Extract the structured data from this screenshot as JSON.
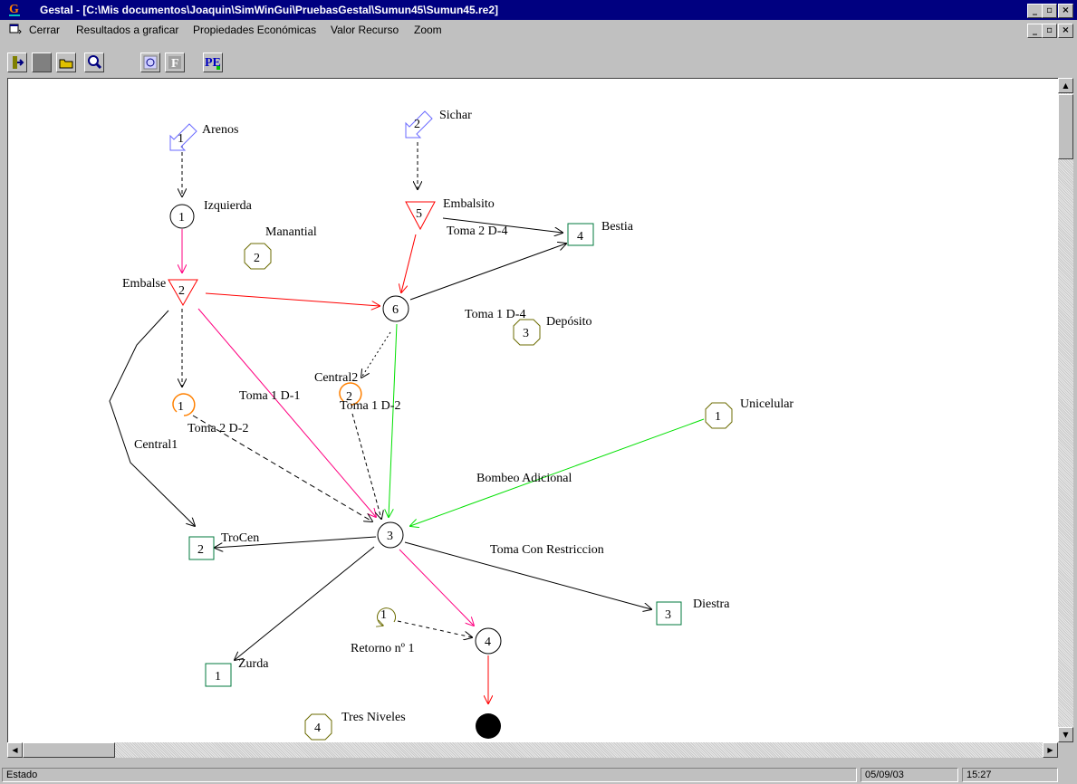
{
  "window": {
    "title": "Gestal - [C:\\Mis documentos\\Joaquin\\SimWinGui\\PruebasGestal\\Sumun45\\Sumun45.re2]",
    "app_icon": "G"
  },
  "menu": [
    "Cerrar",
    "Resultados a graficar",
    "Propiedades Económicas",
    "Valor Recurso",
    "Zoom"
  ],
  "toolbar": {
    "pe_label": "PE"
  },
  "scheme": {
    "aportaciones": [
      {
        "id": "1",
        "name": "Arenos"
      },
      {
        "id": "2",
        "name": "Sichar"
      }
    ],
    "nudos": [
      {
        "id": "1",
        "name": "Izquierda"
      },
      {
        "id": "6",
        "name": ""
      },
      {
        "id": "3",
        "name": ""
      },
      {
        "id": "4",
        "name": ""
      }
    ],
    "embalses": [
      {
        "id": "2",
        "name": "Embalse"
      },
      {
        "id": "5",
        "name": "Embalsito"
      }
    ],
    "acuiferos": [
      {
        "id": "2",
        "name": "Manantial"
      },
      {
        "id": "3",
        "name": "Depósito"
      },
      {
        "id": "1",
        "name": "Unicelular"
      },
      {
        "id": "4",
        "name": "Tres Niveles"
      }
    ],
    "demandas": [
      {
        "id": "4",
        "name": "Bestia"
      },
      {
        "id": "2",
        "name": "TroCen"
      },
      {
        "id": "3",
        "name": "Diestra"
      },
      {
        "id": "1",
        "name": "Zurda"
      }
    ],
    "centrales": [
      {
        "id": "1",
        "name": "Central1"
      },
      {
        "id": "2",
        "name": "Central2"
      }
    ],
    "retorno": {
      "id": "1",
      "name": "Retorno nº 1"
    },
    "tomas": [
      {
        "name": "Toma 2 D-4"
      },
      {
        "name": "Toma 1 D-4"
      },
      {
        "name": "Toma 1 D-1"
      },
      {
        "name": "Toma 1 D-2"
      },
      {
        "name": "Toma 2 D-2"
      },
      {
        "name": "Bombeo Adicional"
      },
      {
        "name": "Toma Con Restriccion"
      }
    ]
  },
  "colors": {
    "title_bar": "#000080",
    "aportacion": "#6a6aff",
    "embalse": "#ff0000",
    "acuifero": "#6b6b00",
    "demanda": "#007a3d",
    "central": "#ff8000",
    "green_conduction": "#00e000",
    "pink_conduction": "#ff0080",
    "red_conduction": "#ff0000"
  },
  "status": {
    "text": "Estado",
    "date": "05/09/03",
    "time": "15:27"
  }
}
